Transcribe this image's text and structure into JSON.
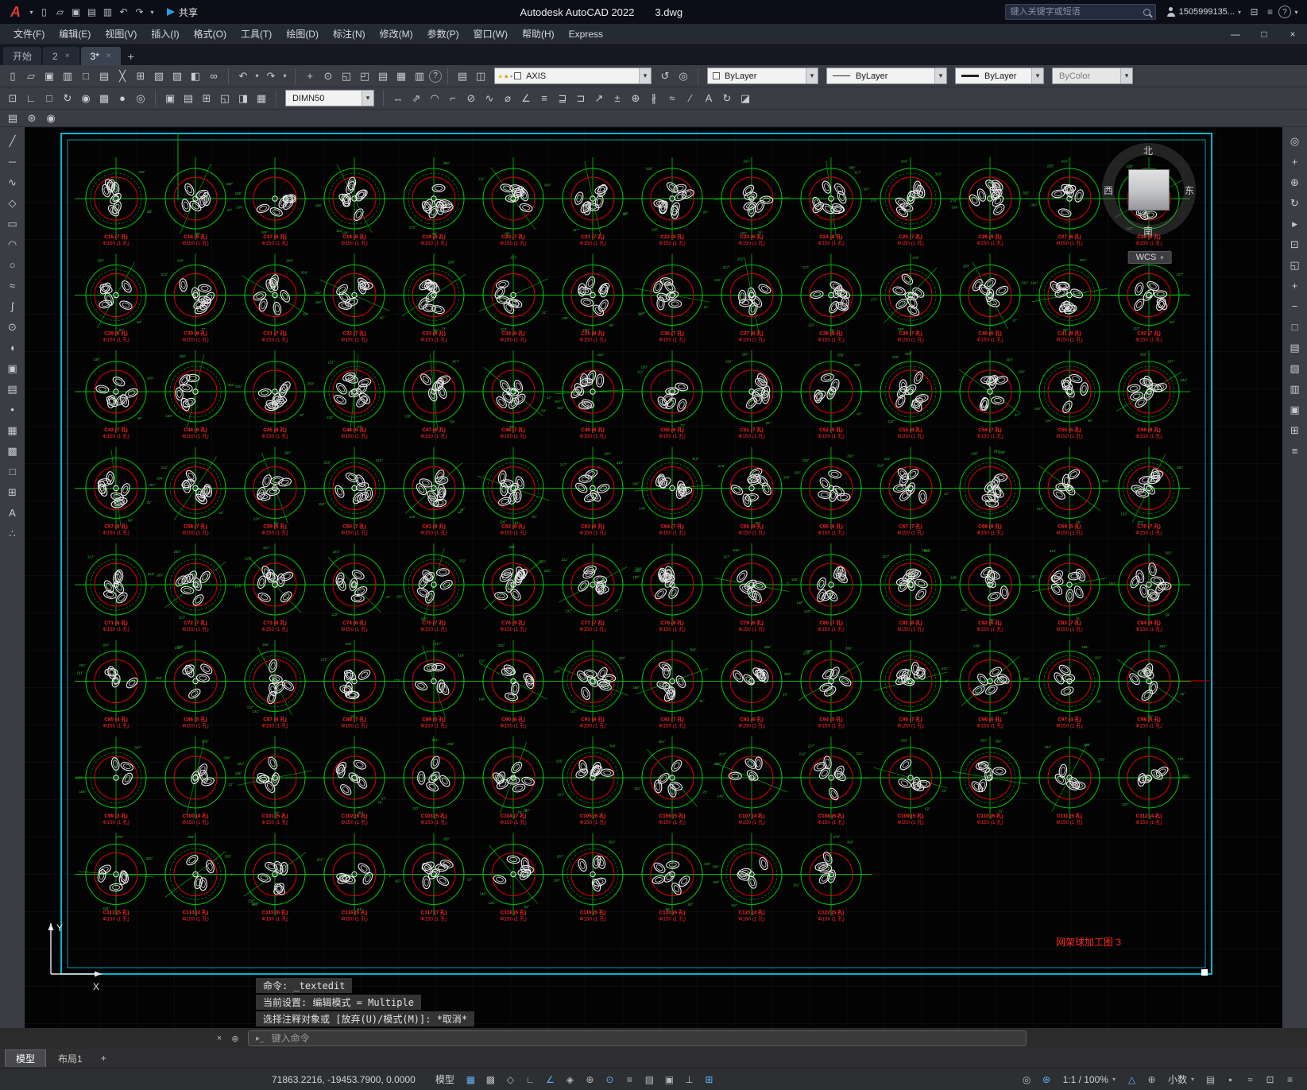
{
  "titlebar": {
    "logo_letter": "A",
    "qat_icons": [
      {
        "n": "app-menu-arrow-icon",
        "g": "▾",
        "narrow": true
      },
      {
        "n": "new-file-icon",
        "g": "▯"
      },
      {
        "n": "open-file-icon",
        "g": "▱"
      },
      {
        "n": "save-icon",
        "g": "▣"
      },
      {
        "n": "save-as-icon",
        "g": "▤"
      },
      {
        "n": "plot-icon",
        "g": "▥"
      },
      {
        "n": "undo-icon",
        "g": "↶"
      },
      {
        "n": "redo-icon",
        "g": "↷"
      },
      {
        "n": "qat-customize-icon",
        "g": "▾",
        "narrow": true
      }
    ],
    "share_label": "共享",
    "app_title": "Autodesk AutoCAD 2022",
    "doc_title": "3.dwg",
    "search_placeholder": "键入关键字或短语",
    "user_name": "1505999135...",
    "arrow": "▾",
    "right_icons": [
      {
        "n": "store-cart-icon",
        "g": "⊟"
      },
      {
        "n": "apps-menu-icon",
        "g": "≡"
      },
      {
        "n": "help-icon",
        "g": "?"
      },
      {
        "n": "help-arrow-icon",
        "g": "▾",
        "narrow": true
      }
    ]
  },
  "menubar": {
    "items": [
      "文件(F)",
      "编辑(E)",
      "视图(V)",
      "插入(I)",
      "格式(O)",
      "工具(T)",
      "绘图(D)",
      "标注(N)",
      "修改(M)",
      "参数(P)",
      "窗口(W)",
      "帮助(H)",
      "Express"
    ],
    "minimize": "—",
    "restore": "□",
    "close": "×"
  },
  "file_tabs": {
    "tabs": [
      {
        "label": "开始",
        "active": false,
        "closable": false
      },
      {
        "label": "2",
        "active": false,
        "closable": true
      },
      {
        "label": "3*",
        "active": true,
        "closable": true
      }
    ],
    "close_glyph": "×",
    "add_glyph": "+"
  },
  "toolbars": {
    "arrow": "▾",
    "row1_a": [
      {
        "n": "new-file-icon",
        "g": "▯"
      },
      {
        "n": "open-file-icon",
        "g": "▱"
      },
      {
        "n": "save-file-icon",
        "g": "▣"
      },
      {
        "n": "plot-icon",
        "g": "▥"
      },
      {
        "n": "plot-preview-icon",
        "g": "□"
      },
      {
        "n": "publish-icon",
        "g": "▤"
      },
      {
        "n": "cut-clip-icon",
        "g": "╳"
      },
      {
        "n": "copy-clip-icon",
        "g": "⊞"
      },
      {
        "n": "paste-clip-icon",
        "g": "▨"
      },
      {
        "n": "match-properties-icon",
        "g": "▧"
      },
      {
        "n": "block-editor-icon",
        "g": "◧"
      },
      {
        "n": "hyperlink-icon",
        "g": "∞"
      }
    ],
    "row1_undo": [
      {
        "n": "undo-icon",
        "g": "↶"
      },
      {
        "n": "undo-list-arrow-icon",
        "g": "▾",
        "narrow": true
      },
      {
        "n": "redo-icon",
        "g": "↷"
      },
      {
        "n": "redo-list-arrow-icon",
        "g": "▾",
        "narrow": true
      }
    ],
    "row1_b": [
      {
        "n": "pan-realtime-icon",
        "g": "+"
      },
      {
        "n": "zoom-realtime-icon",
        "g": "⊙"
      },
      {
        "n": "zoom-window-icon",
        "g": "◱"
      },
      {
        "n": "zoom-previous-icon",
        "g": "◰"
      },
      {
        "n": "properties-palette-icon",
        "g": "▤"
      },
      {
        "n": "designcenter-icon",
        "g": "▦"
      },
      {
        "n": "toolpalettes-icon",
        "g": "▥"
      },
      {
        "n": "help-icon",
        "g": "?"
      }
    ],
    "layer_pre": [
      {
        "n": "layer-properties-icon",
        "g": "▤"
      },
      {
        "n": "layer-states-icon",
        "g": "◫"
      }
    ],
    "layer_chips": [
      {
        "n": "layer-on-bulb-icon",
        "g": "●",
        "c": "#e8c832"
      },
      {
        "n": "layer-freeze-sun-icon",
        "g": "●",
        "c": "#e89a3a"
      },
      {
        "n": "layer-lock-icon",
        "g": "▪",
        "c": "#9a9da3"
      }
    ],
    "layer_post": [
      {
        "n": "layer-previous-icon",
        "g": "↺"
      },
      {
        "n": "layer-isolate-icon",
        "g": "◎"
      }
    ],
    "layer_value": "AXIS",
    "color_value": "ByLayer",
    "linetype_value": "ByLayer",
    "lineweight_value": "ByLayer",
    "plotstyle_value": "ByColor",
    "dimstyle_value": "DIMN50",
    "row2_a": [
      {
        "n": "osnap-settings-icon",
        "g": "⊡"
      },
      {
        "n": "ucs-icon",
        "g": "∟"
      },
      {
        "n": "named-views-icon",
        "g": "□"
      },
      {
        "n": "orbit-icon",
        "g": "↻"
      },
      {
        "n": "render-icon",
        "g": "◉"
      },
      {
        "n": "materials-icon",
        "g": "▩"
      },
      {
        "n": "lights-icon",
        "g": "●"
      },
      {
        "n": "camera-icon",
        "g": "◎"
      }
    ],
    "row2_b": [
      {
        "n": "insert-block-icon",
        "g": "▣"
      },
      {
        "n": "create-block-icon",
        "g": "▤"
      },
      {
        "n": "xref-attach-icon",
        "g": "⊞"
      },
      {
        "n": "clip-xref-icon",
        "g": "◱"
      },
      {
        "n": "image-adjust-icon",
        "g": "◨"
      },
      {
        "n": "frame-toggle-icon",
        "g": "▦"
      }
    ],
    "row2_dim": [
      {
        "n": "linear-dimension-icon",
        "g": "↔"
      },
      {
        "n": "aligned-dimension-icon",
        "g": "⇗"
      },
      {
        "n": "arc-length-dimension-icon",
        "g": "◠"
      },
      {
        "n": "ordinate-dimension-icon",
        "g": "⌐"
      },
      {
        "n": "radius-dimension-icon",
        "g": "⊘"
      },
      {
        "n": "jogged-dimension-icon",
        "g": "∿"
      },
      {
        "n": "diameter-dimension-icon",
        "g": "⌀"
      },
      {
        "n": "angular-dimension-icon",
        "g": "∠"
      },
      {
        "n": "quick-dimension-icon",
        "g": "≡"
      },
      {
        "n": "baseline-dimension-icon",
        "g": "⊒"
      },
      {
        "n": "continue-dimension-icon",
        "g": "⊐"
      },
      {
        "n": "multileader-icon",
        "g": "↗"
      },
      {
        "n": "tolerance-icon",
        "g": "±"
      },
      {
        "n": "center-mark-icon",
        "g": "⊕"
      },
      {
        "n": "dimension-break-icon",
        "g": "∦"
      },
      {
        "n": "dimension-space-icon",
        "g": "≈"
      },
      {
        "n": "dimension-edit-icon",
        "g": "∕"
      },
      {
        "n": "dimension-text-edit-icon",
        "g": "A"
      },
      {
        "n": "dimension-update-icon",
        "g": "↻"
      },
      {
        "n": "dimension-style-icon",
        "g": "◪"
      }
    ],
    "row3": [
      {
        "n": "quick-properties-icon",
        "g": "▤"
      },
      {
        "n": "workspace-icon",
        "g": "⊛"
      },
      {
        "n": "annotation-monitor-icon",
        "g": "◉"
      }
    ]
  },
  "left_tools": [
    {
      "n": "line-tool-icon",
      "g": "╱"
    },
    {
      "n": "construction-line-tool-icon",
      "g": "─"
    },
    {
      "n": "polyline-tool-icon",
      "g": "∿"
    },
    {
      "n": "polygon-tool-icon",
      "g": "◇"
    },
    {
      "n": "rectangle-tool-icon",
      "g": "▭"
    },
    {
      "n": "arc-tool-icon",
      "g": "◠"
    },
    {
      "n": "circle-tool-icon",
      "g": "○"
    },
    {
      "n": "revision-cloud-tool-icon",
      "g": "≈"
    },
    {
      "n": "spline-tool-icon",
      "g": "∫"
    },
    {
      "n": "ellipse-tool-icon",
      "g": "⊙"
    },
    {
      "n": "ellipse-arc-tool-icon",
      "g": "◖"
    },
    {
      "n": "insert-block-tool-icon",
      "g": "▣"
    },
    {
      "n": "make-block-tool-icon",
      "g": "▤"
    },
    {
      "n": "point-tool-icon",
      "g": "•"
    },
    {
      "n": "hatch-tool-icon",
      "g": "▦"
    },
    {
      "n": "gradient-tool-icon",
      "g": "▩"
    },
    {
      "n": "region-tool-icon",
      "g": "□"
    },
    {
      "n": "table-tool-icon",
      "g": "⊞"
    },
    {
      "n": "text-tool-icon",
      "g": "A"
    },
    {
      "n": "point-style-tool-icon",
      "g": "∴"
    }
  ],
  "right_tools": [
    {
      "n": "navigation-wheel-icon",
      "g": "◎"
    },
    {
      "n": "pan-tool-icon",
      "g": "+"
    },
    {
      "n": "zoom-tool-icon",
      "g": "⊕"
    },
    {
      "n": "orbit-tool-icon",
      "g": "↻"
    },
    {
      "n": "showmotion-icon",
      "g": "▸"
    },
    {
      "n": "zoom-extents-icon",
      "g": "⊡"
    },
    {
      "n": "zoom-window-tool-icon",
      "g": "◱"
    },
    {
      "n": "zoom-in-icon",
      "g": "+"
    },
    {
      "n": "zoom-out-icon",
      "g": "−"
    },
    {
      "n": "named-views-tool-icon",
      "g": "□"
    },
    {
      "n": "sheet-set-manager-icon",
      "g": "▤"
    },
    {
      "n": "markup-set-manager-icon",
      "g": "▧"
    },
    {
      "n": "properties-panel-icon",
      "g": "▥"
    },
    {
      "n": "blocks-palette-icon",
      "g": "▣"
    },
    {
      "n": "count-palette-icon",
      "g": "⊞"
    },
    {
      "n": "command-macros-icon",
      "g": "≡"
    }
  ],
  "viewcube": {
    "north": "北",
    "south": "南",
    "west": "西",
    "east": "东",
    "wcs": "WCS",
    "arrow": "▾"
  },
  "canvas": {
    "note": "网架球加工图 3",
    "cells": {
      "prefix": "C",
      "start_number": 15,
      "hole_suffix": "孔",
      "phi_label": "Φ150 (1 孔)",
      "rows": [
        14,
        14,
        14,
        14,
        14,
        14,
        14,
        10
      ],
      "holes": [
        7,
        6,
        6,
        8,
        8,
        7,
        7,
        9,
        6,
        8,
        7,
        9,
        6,
        8,
        6,
        8,
        7,
        7,
        8,
        6,
        8,
        7,
        6,
        8,
        7,
        6,
        9,
        7,
        7,
        6,
        8,
        9,
        6,
        7,
        8,
        6,
        7,
        5,
        8,
        7,
        6,
        8,
        8,
        7,
        6,
        7,
        9,
        8,
        6,
        7,
        8,
        6,
        7,
        8,
        5,
        7,
        6,
        7,
        8,
        6,
        7,
        9,
        7,
        8,
        6,
        7,
        8,
        6,
        7,
        9,
        4,
        5,
        6,
        7,
        5,
        6,
        8,
        7,
        6,
        5,
        7,
        6,
        4,
        6,
        3,
        4,
        5,
        6,
        5,
        7,
        6,
        5,
        4,
        6,
        5,
        6,
        5,
        4,
        5,
        4,
        6,
        5,
        7,
        6,
        5,
        6,
        4,
        5
      ]
    },
    "ucs_x_label": "X",
    "ucs_y_label": "Y"
  },
  "command": {
    "line1": "命令: _textedit",
    "line2": "当前设置: 编辑模式 = Multiple",
    "line3": "选择注释对象或 [放弃(U)/模式(M)]: *取消*",
    "placeholder": "键入命令",
    "close_glyph": "×",
    "customize_glyph": "⊛",
    "prompt_glyph": "▸_"
  },
  "layout_tabs": {
    "tabs": [
      {
        "label": "模型",
        "active": true
      },
      {
        "label": "布局1",
        "active": false
      }
    ],
    "add_glyph": "+"
  },
  "statusbar": {
    "coords": "71863.2216, -19453.7900, 0.0000",
    "arrow": "▾",
    "left_items": [
      {
        "n": "model-space-button",
        "label": "模型"
      },
      {
        "n": "grid-display-button",
        "g": "▦",
        "active": true
      },
      {
        "n": "snap-mode-button",
        "g": "▩"
      },
      {
        "n": "infer-constraints-button",
        "g": "◇"
      },
      {
        "n": "ortho-mode-button",
        "g": "∟"
      },
      {
        "n": "polar-tracking-button",
        "g": "∠",
        "active": true
      },
      {
        "n": "isometric-drafting-button",
        "g": "◈"
      },
      {
        "n": "object-snap-tracking-button",
        "g": "⊕"
      },
      {
        "n": "object-snap-button",
        "g": "⊙",
        "active": true
      },
      {
        "n": "lineweight-display-button",
        "g": "≡"
      },
      {
        "n": "transparency-button",
        "g": "▨"
      },
      {
        "n": "selection-cycling-button",
        "g": "▣"
      },
      {
        "n": "dynamic-ucs-button",
        "g": "⊥"
      },
      {
        "n": "dynamic-input-button",
        "g": "⊞",
        "active": true
      }
    ],
    "right_items": [
      {
        "n": "isolate-objects-button",
        "g": "◎"
      },
      {
        "n": "hardware-acceleration-button",
        "g": "⊛",
        "active": true
      },
      {
        "n": "annotation-scale-button",
        "label": "1:1 / 100%",
        "arrow": true
      },
      {
        "n": "annotation-visibility-button",
        "g": "△",
        "active": true
      },
      {
        "n": "autoscale-button",
        "g": "⊕"
      },
      {
        "n": "units-button",
        "label": "小数",
        "arrow": true
      },
      {
        "n": "quick-properties-button",
        "g": "▤"
      },
      {
        "n": "lock-ui-button",
        "g": "▪"
      },
      {
        "n": "graphics-performance-button",
        "g": "≈"
      },
      {
        "n": "clean-screen-button",
        "g": "⊡"
      },
      {
        "n": "customization-menu-button",
        "g": "≡"
      }
    ]
  }
}
